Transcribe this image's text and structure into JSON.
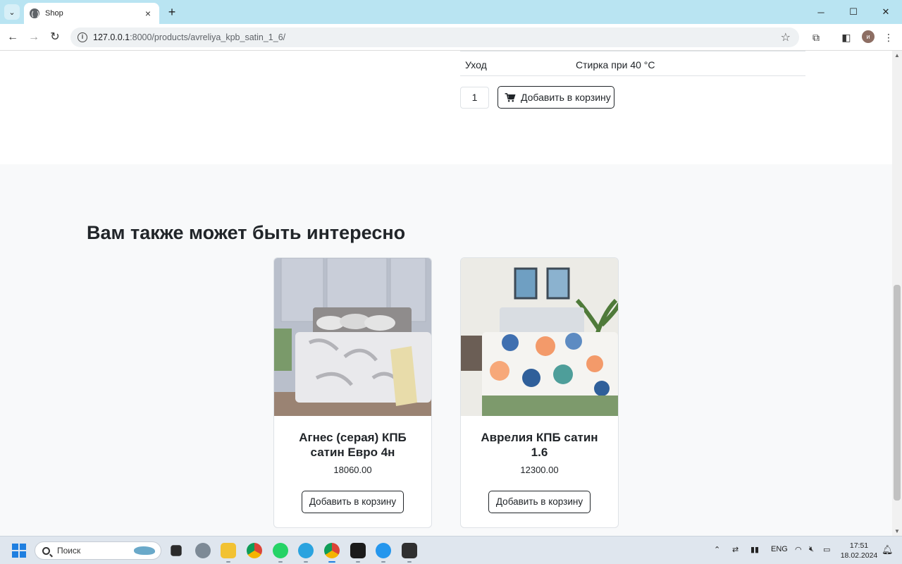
{
  "browser": {
    "tab_title": "Shop",
    "tab_close": "×",
    "new_tab": "+",
    "url_host": "127.0.0.1",
    "url_path": ":8000/products/avreliya_kpb_satin_1_6/",
    "profile_initial": "и",
    "window_controls": [
      "─",
      "☐",
      "✕"
    ]
  },
  "product": {
    "spec": {
      "key": "Уход",
      "value": "Стирка при 40 °C"
    },
    "quantity": "1",
    "add_to_cart": "Добавить в корзину"
  },
  "related": {
    "heading": "Вам также может быть интересно",
    "cards": [
      {
        "title": "Агнес (серая) КПБ сатин Евро 4н",
        "price": "18060.00",
        "button": "Добавить в корзину"
      },
      {
        "title": "Аврелия КПБ сатин 1.6",
        "price": "12300.00",
        "button": "Добавить в корзину"
      }
    ]
  },
  "taskbar": {
    "search_placeholder": "Поиск",
    "lang": "ENG",
    "time": "17:51",
    "date": "18.02.2024"
  },
  "colors": {
    "tabbar": "#b9e4f2",
    "page_alt_bg": "#f8f9fa",
    "text": "#212529"
  }
}
